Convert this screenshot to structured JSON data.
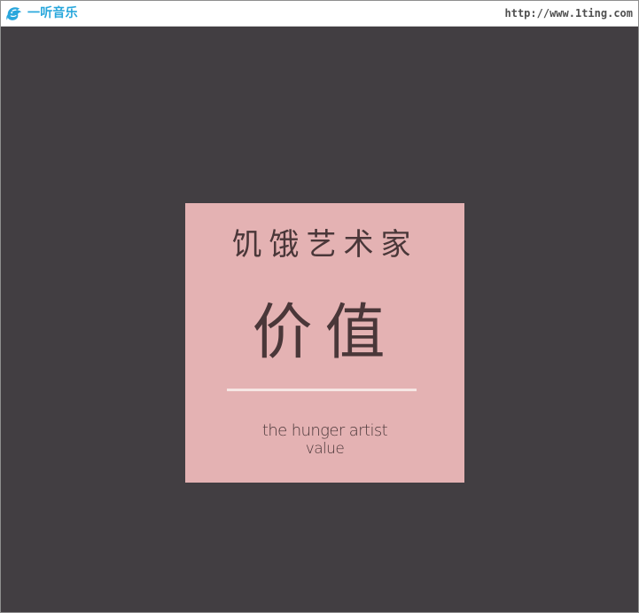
{
  "header": {
    "logo_icon": "dolphin-logo-icon",
    "logo_text": "一听音乐",
    "site_url": "http://www.1ting.com"
  },
  "cover": {
    "title_cn": "饥饿艺术家",
    "subtitle_cn": "价值",
    "english_line_1": "the hunger artist",
    "english_line_2": "value"
  },
  "colors": {
    "frame_border": "#8f8f8f",
    "background": "#423e42",
    "cover_background": "#e4b2b3",
    "cover_text": "#4a3739",
    "divider": "#f6e6e4",
    "logo_text": "#28a7dc",
    "url_text": "#4f4f4f"
  }
}
